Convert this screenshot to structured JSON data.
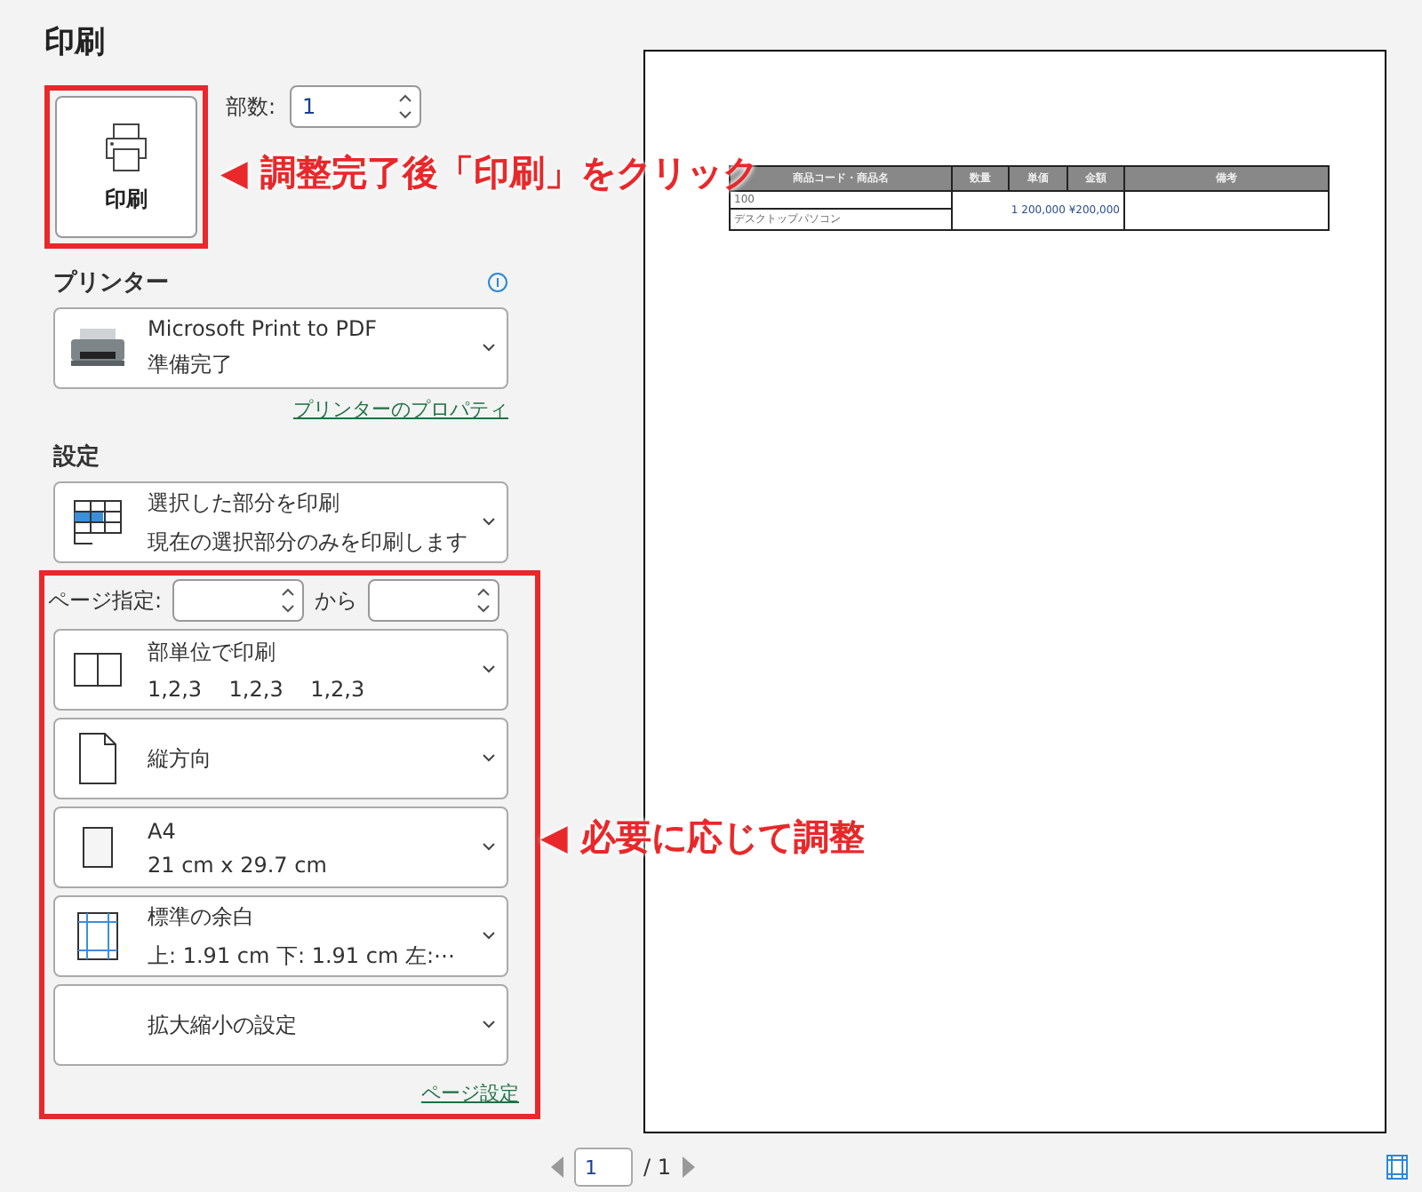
{
  "title": "印刷",
  "print_button": {
    "label": "印刷"
  },
  "copies": {
    "label": "部数:",
    "value": "1"
  },
  "printer": {
    "heading": "プリンター",
    "name": "Microsoft Print to PDF",
    "status": "準備完了",
    "properties_link": "プリンターのプロパティ"
  },
  "settings": {
    "heading": "設定",
    "what": {
      "kind": "selection",
      "title": "選択した部分を印刷",
      "detail": "現在の選択部分のみを印刷します"
    },
    "page_range": {
      "label": "ページ指定:",
      "separator": "から"
    },
    "options": [
      {
        "kind": "collate",
        "title": "部単位で印刷",
        "detail": "1,2,3    1,2,3    1,2,3"
      },
      {
        "kind": "orientation",
        "title": "縦方向"
      },
      {
        "kind": "paper",
        "title": "A4",
        "detail": "21 cm x 29.7 cm"
      },
      {
        "kind": "margins",
        "title": "標準の余白",
        "detail": "上: 1.91 cm 下: 1.91 cm 左:⋯"
      },
      {
        "kind": "scaling",
        "title": "拡大縮小の設定"
      }
    ],
    "page_setup_link": "ページ設定"
  },
  "annotations": [
    {
      "text": "◀ 調整完了後「印刷」をクリック"
    },
    {
      "text": "◀ 必要に応じて調整"
    }
  ],
  "preview": {
    "columns": [
      "商品コード・商品名",
      "数量",
      "単価",
      "金額",
      "備考"
    ],
    "row": {
      "code": "100",
      "name": "デスクトップパソコン",
      "quantity": "1",
      "price": "200,000",
      "amount": "¥200,000"
    },
    "pager": {
      "value": "1",
      "total": "/ 1"
    }
  }
}
